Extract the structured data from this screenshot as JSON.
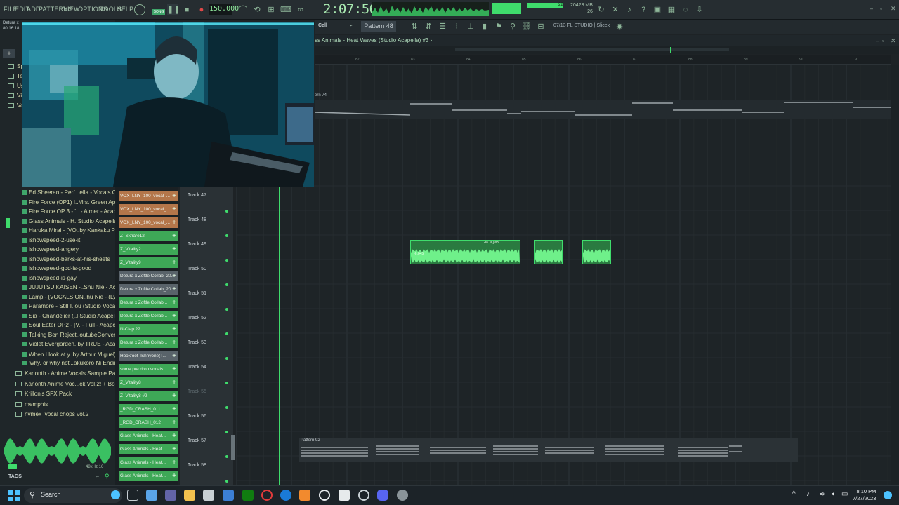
{
  "menu": {
    "file": "FILE",
    "edit": "EDIT",
    "add": "ADD",
    "patterns": "PATTERNS",
    "view": "VIEW",
    "options": "OPTIONS",
    "tools": "TOOLS",
    "help": "HELP"
  },
  "transport": {
    "mode": "SONG",
    "tempo": "150.000",
    "time": "2:07:56"
  },
  "monitor": {
    "cpu_mb": "20423 MB",
    "polyphony": "26",
    "cpu_percent": "22"
  },
  "toolbar2": {
    "cell": "Cell",
    "pattern": "Pattern 48",
    "hint": "07/13  FL STUDIO | Slicex"
  },
  "playlist": {
    "title": "ss Animals - Heat Waves (Studio Acapella) #3 ›",
    "bar_numbers": [
      "82",
      "83",
      "84",
      "85",
      "86",
      "87",
      "88",
      "89",
      "90",
      "91"
    ],
    "pattern_label_top": "ern 74",
    "pattern_label_bottom": "Pattern 92",
    "clip_main": "Gla..la] #3",
    "clip_value": "-6.045"
  },
  "browser": {
    "header_line1": "Detura x",
    "header_line2": "80:16:18",
    "folders_top": [
      "Sp",
      "Te",
      "Us",
      "Vi",
      "Vo"
    ],
    "items": [
      "Ed Sheeran - Perf...ella - Vocals Only)",
      "Fire Force (OP1) I..Mrs. Green Apple",
      "Fire Force OP 3 - '...- Aimer - Acapella",
      "Glass Animals - H..Studio Acapella)",
      "Haruka Mirai - [VO..by Kankaku Piero",
      "ishowspeed-2-use-it",
      "ishowspeed-angery",
      "ishowspeed-barks-at-his-sheets",
      "ishowspeed-god-is-good",
      "ishowspeed-is-gay",
      "JUJUTSU KAISEN -..Shu Nie - Acapella",
      "Lamp - [VOCALS ON..hu Nie - (Lyrics)",
      "Paramore - Still I..ou (Studio Vocals)",
      "Sia - Chandelier (..l Studio Acapella)",
      "Soul Eater OP2 - [V..- Full - Acapella",
      "Talking Ben Reject..outubeConvert.cc",
      "Violet Evergarden..by TRUE - Acapella",
      "When I look at y..by Arthur Miguel) ★",
      "'why, or why not'..akukoro Ni Ending"
    ],
    "folders": [
      "Kanonth - Anime Vocals Sample Pack!!",
      "Kanonth Anime Voc...ck Vol.2! + Bonus",
      "Krillon's SFX Pack",
      "memphis",
      "nvmex_vocal chops vol.2"
    ],
    "sample_rate": "48kHz 16",
    "tags": "TAGS"
  },
  "clips": [
    {
      "label": "VOX_LNY_100_vocal_...",
      "color": "orange"
    },
    {
      "label": "VOX_LNY_100_vocal_...",
      "color": "orange"
    },
    {
      "label": "VOX_LNY_100_vocal_...",
      "color": "orange"
    },
    {
      "label": "Z_Sknare12",
      "color": "green"
    },
    {
      "label": "Z_Vitality2",
      "color": "green"
    },
    {
      "label": "Z_Vitality9",
      "color": "green"
    },
    {
      "label": "Detura x Zoftle Collab_20...",
      "color": "gray"
    },
    {
      "label": "Detura x Zoftle Collab_20...",
      "color": "gray"
    },
    {
      "label": "Detura x Zoftle Collab...",
      "color": "green"
    },
    {
      "label": "Detura x Zoftle Collab...",
      "color": "green"
    },
    {
      "label": "N-Clap 22",
      "color": "green"
    },
    {
      "label": "Detura x Zoftle Collab...",
      "color": "green"
    },
    {
      "label": "Hookfoot_Ishnyone(T...",
      "color": "gray"
    },
    {
      "label": "some pre drop vocals...",
      "color": "green"
    },
    {
      "label": "Z_Vitality8",
      "color": "green"
    },
    {
      "label": "Z_Vitality8 #2",
      "color": "green"
    },
    {
      "label": "_RGD_CRASH_011",
      "color": "green"
    },
    {
      "label": "_RGD_CRASH_012",
      "color": "green"
    },
    {
      "label": "Glass Animals - Heat...",
      "color": "green"
    },
    {
      "label": "Glass Animals - Heat...",
      "color": "green"
    },
    {
      "label": "Glass Animals - Heat...",
      "color": "green"
    },
    {
      "label": "Glass Animals - Heat...",
      "color": "green"
    }
  ],
  "tracks": [
    "Track 47",
    "Track 48",
    "Track 49",
    "Track 50",
    "Track 51",
    "Track 52",
    "Track 53",
    "Track 54",
    "Track 55",
    "Track 56",
    "Track 57",
    "Track 58"
  ],
  "taskbar": {
    "search": "Search",
    "time": "8:10 PM",
    "date": "7/27/2023"
  },
  "colors": {
    "accent": "#3fdc6c",
    "background": "#1e2326",
    "clip_orange": "#b4764a",
    "clip_green": "#3ea857"
  }
}
